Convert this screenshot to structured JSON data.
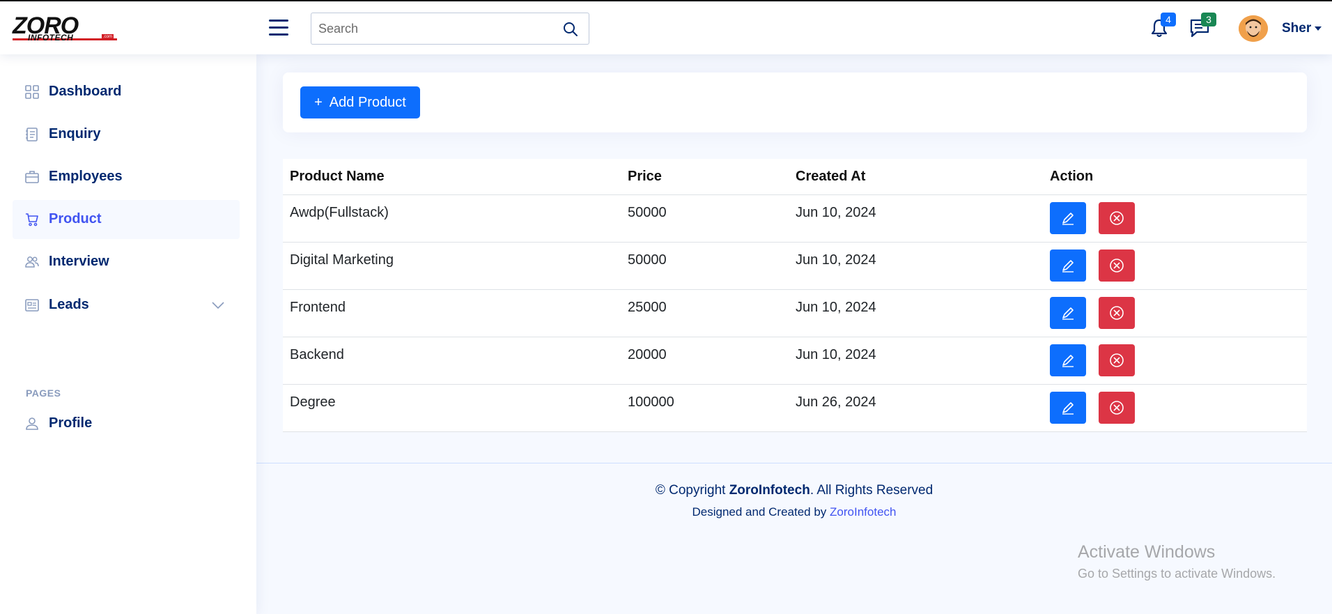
{
  "header": {
    "logo_main": "ZORO",
    "logo_sub": "INFOTECH",
    "logo_tag": ".com",
    "search_placeholder": "Search",
    "notifications_count": "4",
    "messages_count": "3",
    "user_name": "Sher"
  },
  "sidebar": {
    "items": [
      {
        "label": "Dashboard"
      },
      {
        "label": "Enquiry"
      },
      {
        "label": "Employees"
      },
      {
        "label": "Product"
      },
      {
        "label": "Interview"
      },
      {
        "label": "Leads"
      }
    ],
    "section_heading": "PAGES",
    "profile_label": "Profile"
  },
  "main": {
    "add_button_label": "Add Product",
    "table": {
      "headers": [
        "Product Name",
        "Price",
        "Created At",
        "Action"
      ],
      "rows": [
        {
          "name": "Awdp(Fullstack)",
          "price": "50000",
          "created": "Jun 10, 2024"
        },
        {
          "name": "Digital Marketing",
          "price": "50000",
          "created": "Jun 10, 2024"
        },
        {
          "name": "Frontend",
          "price": "25000",
          "created": "Jun 10, 2024"
        },
        {
          "name": "Backend",
          "price": "20000",
          "created": "Jun 10, 2024"
        },
        {
          "name": "Degree",
          "price": "100000",
          "created": "Jun 26, 2024"
        }
      ]
    }
  },
  "footer": {
    "copyright_prefix": "© Copyright ",
    "copyright_brand": "ZoroInfotech",
    "copyright_suffix": ". All Rights Reserved",
    "credits_prefix": "Designed and Created by ",
    "credits_link": "ZoroInfotech"
  },
  "watermark": {
    "line1": "Activate Windows",
    "line2": "Go to Settings to activate Windows."
  },
  "colors": {
    "primary": "#0d6efd",
    "danger": "#dc3545",
    "navy": "#012970",
    "active": "#4154f1",
    "notif_badge": "#0d6efd",
    "msg_badge": "#198754"
  }
}
